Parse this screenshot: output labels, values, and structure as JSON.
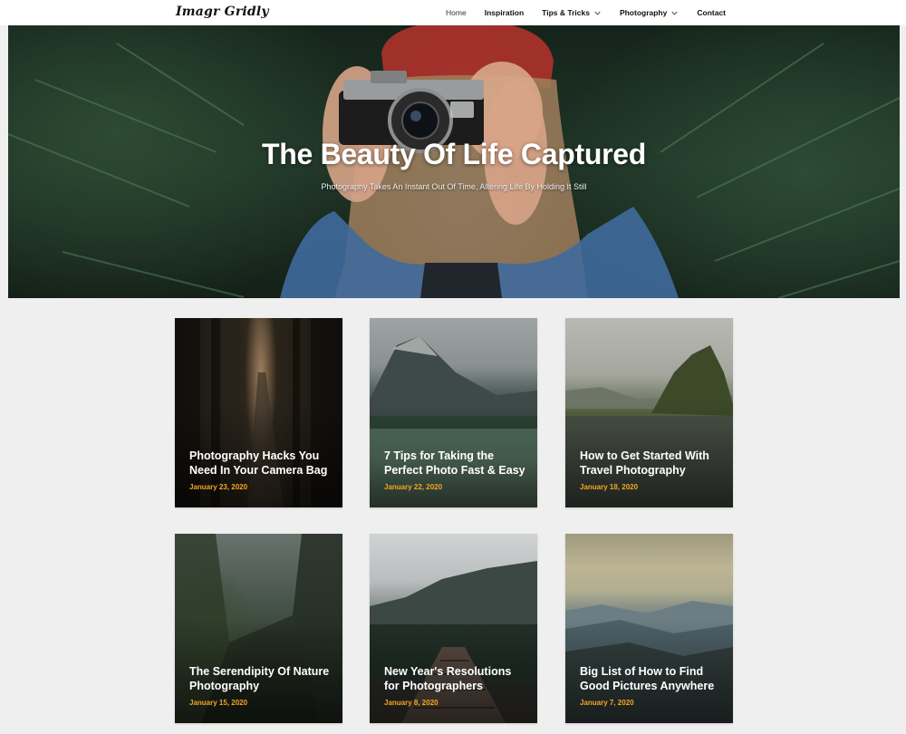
{
  "header": {
    "logo": "Imagr Gridly",
    "nav": [
      {
        "label": "Home",
        "dropdown": false
      },
      {
        "label": "Inspiration",
        "dropdown": false
      },
      {
        "label": "Tips & Tricks",
        "dropdown": true
      },
      {
        "label": "Photography",
        "dropdown": true
      },
      {
        "label": "Contact",
        "dropdown": false
      }
    ]
  },
  "hero": {
    "title": "The Beauty Of Life Captured",
    "subtitle": "Photography Takes An Instant Out Of Time, Altering Life By Holding It Still"
  },
  "posts": [
    {
      "title": "Photography Hacks You Need In Your Camera Bag",
      "date": "January 23, 2020"
    },
    {
      "title": "7 Tips for Taking the Perfect Photo Fast & Easy",
      "date": "January 22, 2020"
    },
    {
      "title": "How to Get Started With Travel Photography",
      "date": "January 18, 2020"
    },
    {
      "title": "The Serendipity Of Nature Photography",
      "date": "January 15, 2020"
    },
    {
      "title": "New Year's Resolutions for Photographers",
      "date": "January 8, 2020"
    },
    {
      "title": "Big List of How to Find Good Pictures Anywhere",
      "date": "January 7, 2020"
    }
  ],
  "colors": {
    "accent_date": "#f5a623",
    "background": "#efefef",
    "header": "#ffffff"
  }
}
